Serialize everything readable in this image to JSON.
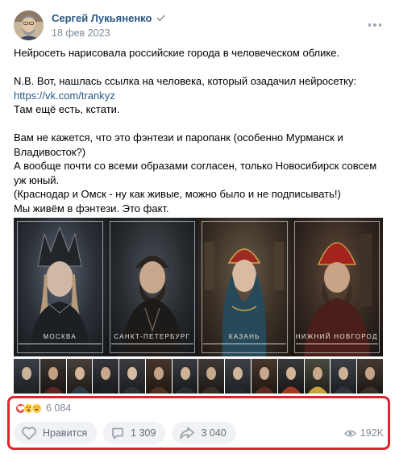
{
  "post": {
    "author": "Сергей Лукьяненко",
    "date": "18 фев 2023",
    "text": {
      "line1": "Нейросеть нарисовала российские города в человеческом облике.",
      "line2": "N.B. Вот, нашлась ссылка на человека, который озадачил нейросетку:",
      "link": "https://vk.com/trankyz",
      "line3": "Там ещё есть, кстати.",
      "line4": "Вам не кажется, что это фэнтези и паропанк (особенно Мурманск и Владивосток?)",
      "line5": "А вообще почти со всеми образами согласен, только Новосибирск совсем уж юный.",
      "line6": "(Краснодар и Омск - ну как живые, можно было и не подписывать!)",
      "line7": "Мы живём в фэнтези. Это факт."
    },
    "images": [
      {
        "caption": "МОСКВА"
      },
      {
        "caption": "САНКТ-ПЕТЕРБУРГ"
      },
      {
        "caption": "КАЗАНЬ"
      },
      {
        "caption": "НИЖНИЙ НОВГОРОД"
      }
    ],
    "thumb_count": 14,
    "reactions": {
      "icons": [
        "heart-icon",
        "surprised-icon",
        "laughing-icon"
      ],
      "count": "6 084"
    },
    "actions": {
      "like_label": "Нравится",
      "comments": "1 309",
      "shares": "3 040"
    },
    "views": "192K"
  },
  "colors": {
    "link": "#2a5885",
    "muted": "#818c99",
    "button_bg": "#f0f2f5",
    "highlight": "#e0242f"
  }
}
